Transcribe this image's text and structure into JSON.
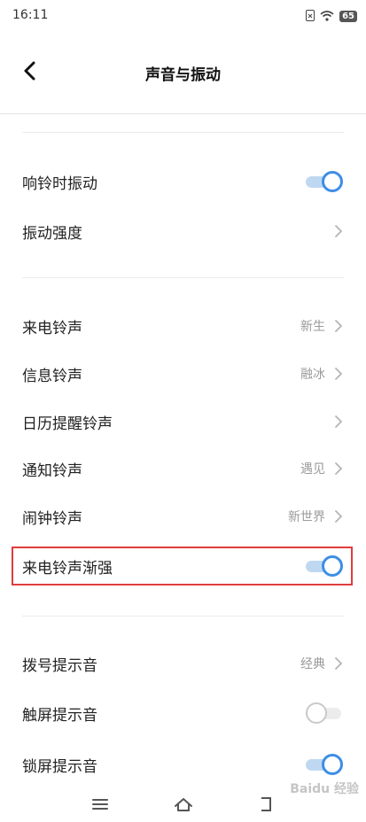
{
  "status_bar": {
    "time": "16:11",
    "battery": "65",
    "icons": [
      "sim-icon",
      "wifi-icon",
      "battery-icon"
    ]
  },
  "header": {
    "title": "声音与振动",
    "back_icon": "chevron-left-icon"
  },
  "section_vibration": [
    {
      "label": "响铃时振动",
      "control": "toggle",
      "on": true
    },
    {
      "label": "振动强度",
      "control": "chevron"
    }
  ],
  "section_ringtones": [
    {
      "label": "来电铃声",
      "value": "新生",
      "control": "chevron"
    },
    {
      "label": "信息铃声",
      "value": "融冰",
      "control": "chevron"
    },
    {
      "label": "日历提醒铃声",
      "value": "",
      "control": "chevron"
    },
    {
      "label": "通知铃声",
      "value": "遇见",
      "control": "chevron"
    },
    {
      "label": "闹钟铃声",
      "value": "新世界",
      "control": "chevron"
    },
    {
      "label": "来电铃声渐强",
      "control": "toggle",
      "on": true,
      "highlighted": true
    }
  ],
  "section_sounds": [
    {
      "label": "拨号提示音",
      "value": "经典",
      "control": "chevron"
    },
    {
      "label": "触屏提示音",
      "control": "toggle",
      "on": false
    },
    {
      "label": "锁屏提示音",
      "control": "toggle",
      "on": true
    }
  ],
  "bottom_nav": {
    "icons": [
      "menu-icon",
      "home-icon",
      "back-icon"
    ]
  },
  "watermark": "Baidu 经验",
  "colors": {
    "accent": "#3d8ee6",
    "highlight": "#e03c3c",
    "value_text": "#9a9a9a"
  }
}
